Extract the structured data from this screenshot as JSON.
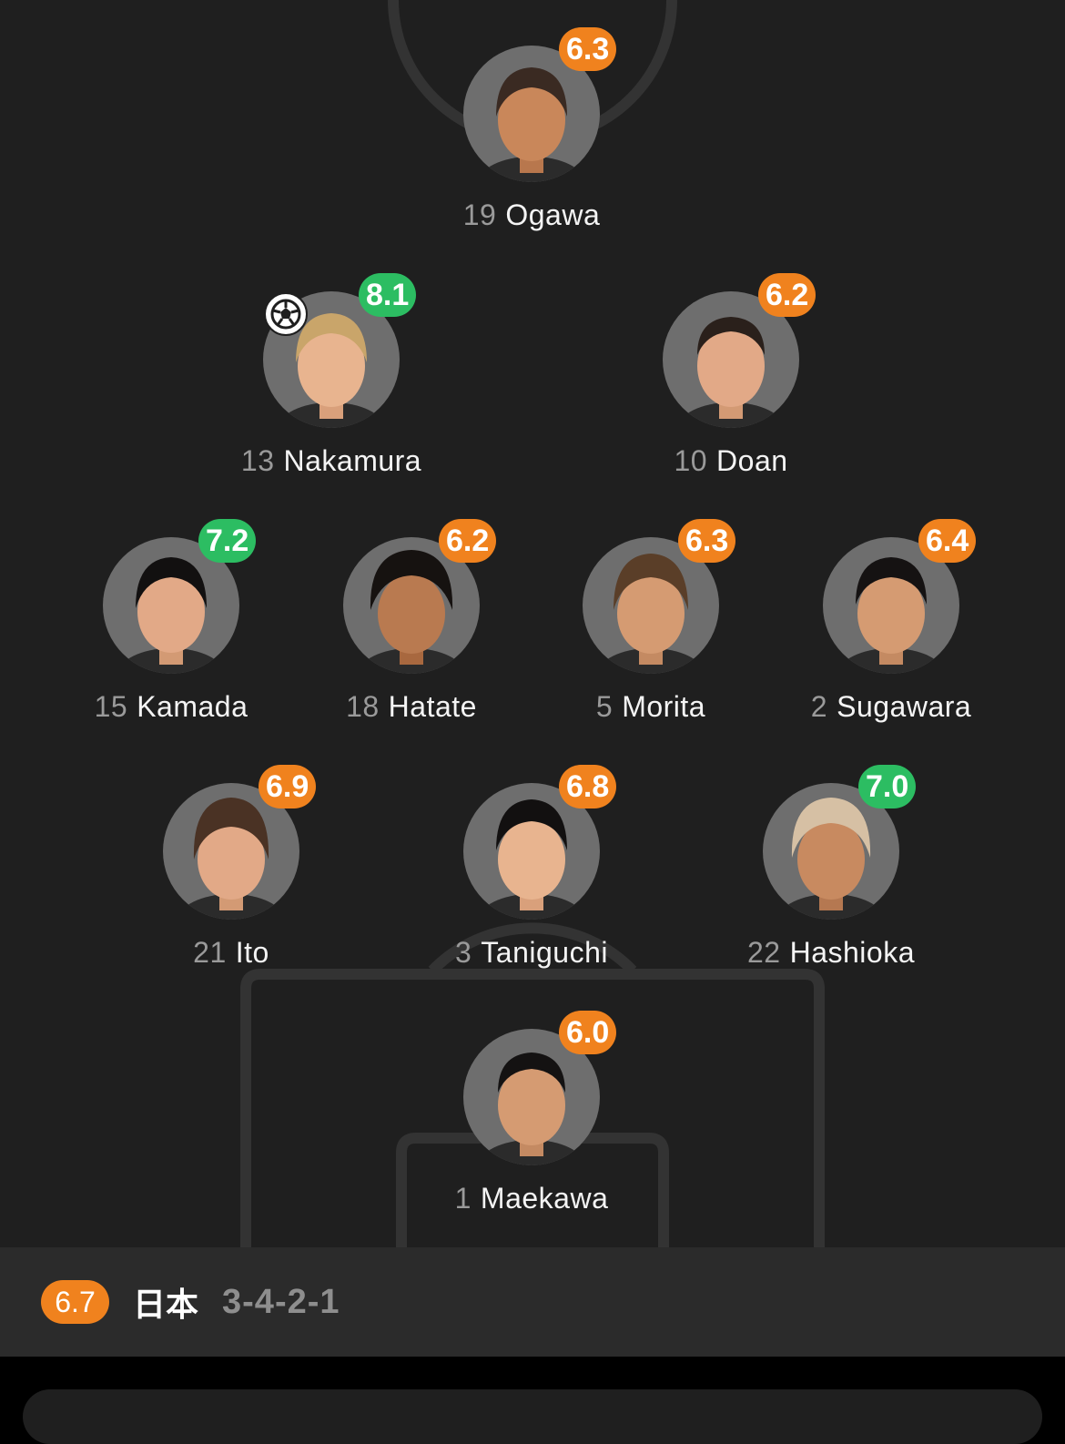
{
  "team": {
    "rating": "6.7",
    "name": "日本",
    "formation": "3-4-2-1"
  },
  "colors": {
    "rating_orange": "#f0821e",
    "rating_green": "#2cbd62",
    "pitch": "#1f1f1f",
    "bar": "#2b2b2b"
  },
  "players": [
    {
      "number": "19",
      "name": "Ogawa",
      "rating": "6.3",
      "rating_color": "orange",
      "goal": false
    },
    {
      "number": "13",
      "name": "Nakamura",
      "rating": "8.1",
      "rating_color": "green",
      "goal": true
    },
    {
      "number": "10",
      "name": "Doan",
      "rating": "6.2",
      "rating_color": "orange",
      "goal": false
    },
    {
      "number": "15",
      "name": "Kamada",
      "rating": "7.2",
      "rating_color": "green",
      "goal": false
    },
    {
      "number": "18",
      "name": "Hatate",
      "rating": "6.2",
      "rating_color": "orange",
      "goal": false
    },
    {
      "number": "5",
      "name": "Morita",
      "rating": "6.3",
      "rating_color": "orange",
      "goal": false
    },
    {
      "number": "2",
      "name": "Sugawara",
      "rating": "6.4",
      "rating_color": "orange",
      "goal": false
    },
    {
      "number": "21",
      "name": "Ito",
      "rating": "6.9",
      "rating_color": "orange",
      "goal": false
    },
    {
      "number": "3",
      "name": "Taniguchi",
      "rating": "6.8",
      "rating_color": "orange",
      "goal": false
    },
    {
      "number": "22",
      "name": "Hashioka",
      "rating": "7.0",
      "rating_color": "green",
      "goal": false
    },
    {
      "number": "1",
      "name": "Maekawa",
      "rating": "6.0",
      "rating_color": "orange",
      "goal": false
    }
  ]
}
